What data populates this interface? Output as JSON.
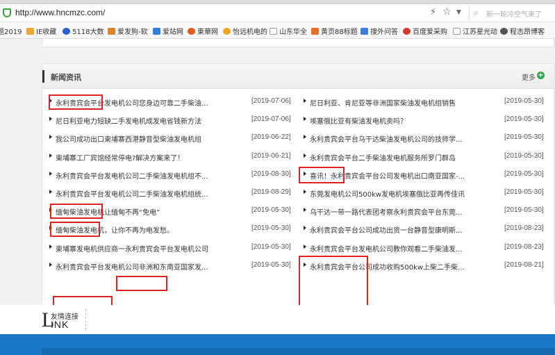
{
  "browser": {
    "url": "http://www.hncmzc.com/",
    "search_placeholder": "新一轮冷空气来了"
  },
  "bookmarks": [
    {
      "label": "题2019",
      "color": "#f3c244"
    },
    {
      "label": "IE收藏",
      "color": "#e8a635"
    },
    {
      "label": "5118大数",
      "color": "#2a62c9"
    },
    {
      "label": "爱发狗-软",
      "color": "#d9862a"
    },
    {
      "label": "爱站网",
      "color": "#2f7fd8"
    },
    {
      "label": "東華网",
      "color": "#e25a1c"
    },
    {
      "label": "怡远机电的",
      "color": "#f0a321"
    },
    {
      "label": "山东华全",
      "color": "#cfcfcf"
    },
    {
      "label": "黄页88标题",
      "color": "#e5702a"
    },
    {
      "label": "搜外问答",
      "color": "#3b7dd8"
    },
    {
      "label": "百度爱采购",
      "color": "#d63a2f"
    },
    {
      "label": "江苏星光动",
      "color": "#cfcfcf"
    },
    {
      "label": "程志昂博客",
      "color": "#555555"
    }
  ],
  "news": {
    "title": "新闻资讯",
    "more": "更多",
    "left": [
      {
        "title": "永利贵宾会平台发电机公司您身边可靠二手柴油...",
        "date": "[2019-07-06]"
      },
      {
        "title": "尼日利亚电力短缺二手发电机成发电省钱新方法",
        "date": "[2019-07-06]"
      },
      {
        "title": "我公司成功出口柬埔寨西港静音型柴油发电机组",
        "date": "[2019-06-22]"
      },
      {
        "title": "柬埔寨工厂宾馆经常停电?解决方案来了！",
        "date": "[2019-06-21]"
      },
      {
        "title": "永利贵宾会平台发电机公司二手柴油发电机组不...",
        "date": "[2019-08-30]"
      },
      {
        "title": "永利贵宾会平台发电机公司二手柴油发电机组统...",
        "date": "[2019-08-29]"
      },
      {
        "title": "缅甸柴油发电机让缅甸不再“免电”",
        "date": "[2019-05-30]"
      },
      {
        "title": "缅甸柴油发电机，让你不再为电发愁。",
        "date": "[2019-05-30]"
      },
      {
        "title": "柬埔寨发电机供应商一永利贵宾会平台发电机公司",
        "date": "[2019-05-30]"
      },
      {
        "title": "永利贵宾会平台发电机公司非洲和东南亚国家发...",
        "date": "[2019-05-30]"
      }
    ],
    "right": [
      {
        "title": "尼日利亚、肯尼亚等非洲国家柴油发电机组销售",
        "date": "[2019-05-30]"
      },
      {
        "title": "埃塞俄比亚有柴油发电机卖吗？",
        "date": "[2019-05-30]"
      },
      {
        "title": "永利贵宾会平台乌干达柴油发电机公司的技师学...",
        "date": "[2019-05-30]"
      },
      {
        "title": "永利贵宾会平台二手柴油发电机服务所罗门群岛",
        "date": "[2019-05-30]"
      },
      {
        "title": "喜讯！永利贵宾会平台公司发电机出口南亚国家-...",
        "date": "[2019-05-30]"
      },
      {
        "title": "东莞发电机公司500kw发电机埃塞俄比亚再传佳讯",
        "date": "[2019-05-30]"
      },
      {
        "title": "乌干达一带一路代表团考察永利贵宾会平台东莞...",
        "date": "[2019-05-30]"
      },
      {
        "title": "永利贵宾会平台公司成功出货一台静音型康明斯...",
        "date": "[2019-08-23]"
      },
      {
        "title": "永利贵宾会平台发电机公司教你观看二手柴油发...",
        "date": "[2019-08-23]"
      },
      {
        "title": "永利贵宾会平台公司成功收购500kw上柴二手柴...",
        "date": "[2019-08-21]"
      }
    ]
  },
  "links": {
    "letter": "L",
    "label_cn": "友情连接",
    "label_en": "INK"
  }
}
